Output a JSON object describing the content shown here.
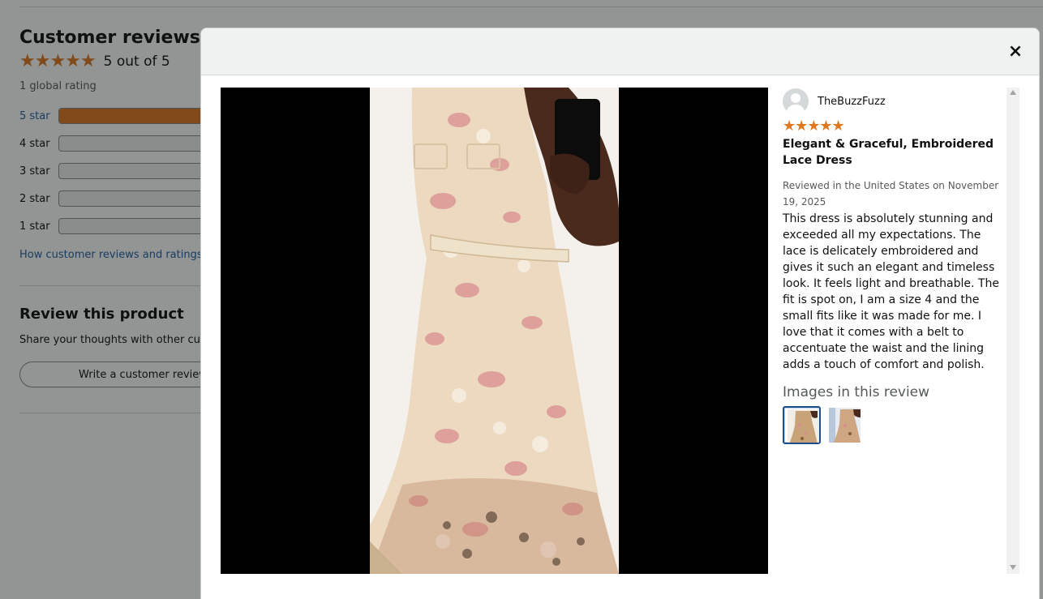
{
  "background": {
    "section_title": "Customer reviews",
    "stars_icon": "★★★★★",
    "rating_text": "5 out of 5",
    "global_rating": "1 global rating",
    "histogram": [
      {
        "label": "5 star",
        "fraction": 1.0
      },
      {
        "label": "4 star",
        "fraction": 0
      },
      {
        "label": "3 star",
        "fraction": 0
      },
      {
        "label": "2 star",
        "fraction": 0
      },
      {
        "label": "1 star",
        "fraction": 0
      }
    ],
    "how_link": "How customer reviews and ratings work",
    "review_product_title": "Review this product",
    "share_text": "Share your thoughts with other customers",
    "write_review_button": "Write a customer review"
  },
  "modal": {
    "close_icon": "×",
    "reviewer_name": "TheBuzzFuzz",
    "review_stars": "★★★★★",
    "review_rating": 5,
    "headline": "Elegant & Graceful, Embroidered Lace Dress",
    "date": "Reviewed in the United States on November 19, 2025",
    "body": "This dress is absolutely stunning and exceeded all my expectations. The lace is delicately embroidered and gives it such an elegant and timeless look. It feels light and breathable. The fit is spot on, I am a size 4 and the small fits like it was made for me. I love that it comes with a belt to accentuate the waist and the lining adds a touch of comfort and polish.",
    "images_heading": "Images in this review",
    "thumbnails": [
      {
        "name": "review-image-1",
        "selected": true
      },
      {
        "name": "review-image-2",
        "selected": false
      }
    ]
  },
  "colors": {
    "star": "#de7921",
    "link": "#2162a1",
    "selected_thumb_border": "#1d4e89",
    "overlay": "rgba(15,17,17,0.45)"
  }
}
